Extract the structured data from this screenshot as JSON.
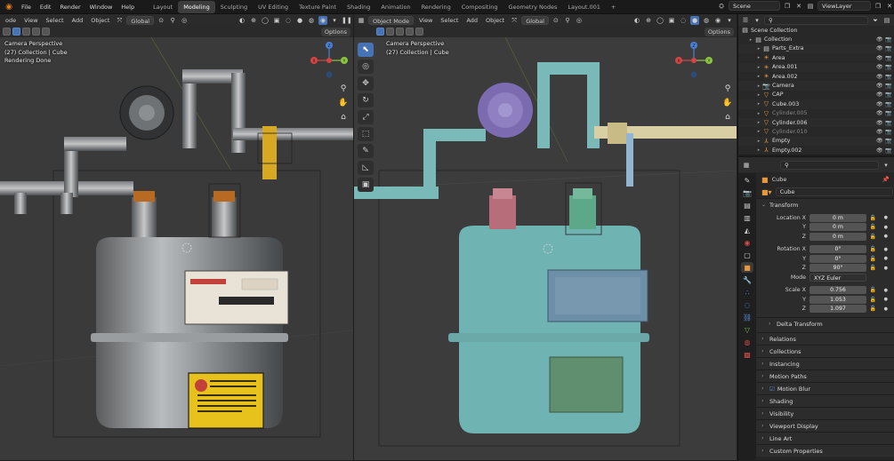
{
  "topbar": {
    "menus": [
      "File",
      "Edit",
      "Render",
      "Window",
      "Help"
    ],
    "workspaces": [
      "Layout",
      "Modeling",
      "Sculpting",
      "UV Editing",
      "Texture Paint",
      "Shading",
      "Animation",
      "Rendering",
      "Compositing",
      "Geometry Nodes",
      "Layout.001",
      "+"
    ],
    "active_workspace": "Modeling",
    "scene": "Scene",
    "view_layer": "ViewLayer"
  },
  "viewport_left": {
    "mode": "ode",
    "menus": [
      "View",
      "Select",
      "Add",
      "Object"
    ],
    "transform": "Global",
    "options": "Options",
    "info": [
      "Camera Perspective",
      "(27) Collection | Cube",
      "Rendering Done"
    ]
  },
  "viewport_right": {
    "mode": "Object Mode",
    "menus": [
      "View",
      "Select",
      "Add",
      "Object"
    ],
    "transform": "Global",
    "options": "Options",
    "info": [
      "Camera Perspective",
      "(27) Collection | Cube"
    ]
  },
  "meter": {
    "left_label_yellow": "",
    "right_colors": {
      "body": "#6fb3b2",
      "dial": "#7c6bb0",
      "knob_red": "#b76e7a",
      "knob_green": "#5ea88a",
      "panel": "#6e8fa8",
      "window": "#5f8f6e",
      "pipe": "#79b9b8",
      "valve": "#cfc39a"
    }
  },
  "outliner": {
    "root": "Scene Collection",
    "items": [
      {
        "label": "Collection",
        "icon": "collection-icon",
        "dim": false,
        "level": 0
      },
      {
        "label": "Parts_Extra",
        "icon": "collection-icon",
        "dim": false,
        "level": 1
      },
      {
        "label": "Area",
        "icon": "light-icon",
        "dim": false,
        "level": 1
      },
      {
        "label": "Area.001",
        "icon": "light-icon",
        "dim": false,
        "level": 1
      },
      {
        "label": "Area.002",
        "icon": "light-icon",
        "dim": false,
        "level": 1
      },
      {
        "label": "Camera",
        "icon": "camera-icon",
        "dim": false,
        "level": 1
      },
      {
        "label": "CAP",
        "icon": "mesh-icon",
        "dim": false,
        "level": 1
      },
      {
        "label": "Cube.003",
        "icon": "mesh-icon",
        "dim": false,
        "level": 1
      },
      {
        "label": "Cylinder.005",
        "icon": "mesh-icon",
        "dim": true,
        "level": 1
      },
      {
        "label": "Cylinder.006",
        "icon": "mesh-icon",
        "dim": false,
        "level": 1
      },
      {
        "label": "Cylinder.010",
        "icon": "mesh-icon",
        "dim": true,
        "level": 1
      },
      {
        "label": "Empty",
        "icon": "empty-icon",
        "dim": false,
        "level": 1
      },
      {
        "label": "Empty.002",
        "icon": "empty-icon",
        "dim": false,
        "level": 1
      }
    ]
  },
  "properties": {
    "object_name": "Cube",
    "data_name": "Cube",
    "transform_label": "Transform",
    "location": {
      "label": "Location X",
      "x": "0 m",
      "y": "0 m",
      "z": "0 m"
    },
    "rotation": {
      "label": "Rotation X",
      "x": "0°",
      "y": "0°",
      "z": "90°"
    },
    "mode": {
      "label": "Mode",
      "value": "XYZ Euler"
    },
    "scale": {
      "label": "Scale X",
      "x": "0.756",
      "y": "1.053",
      "z": "1.097"
    },
    "axis_y": "Y",
    "axis_z": "Z",
    "delta": "Delta Transform",
    "sections": [
      "Relations",
      "Collections",
      "Instancing",
      "Motion Paths",
      "Motion Blur",
      "Shading",
      "Visibility",
      "Viewport Display",
      "Line Art",
      "Custom Properties"
    ]
  }
}
